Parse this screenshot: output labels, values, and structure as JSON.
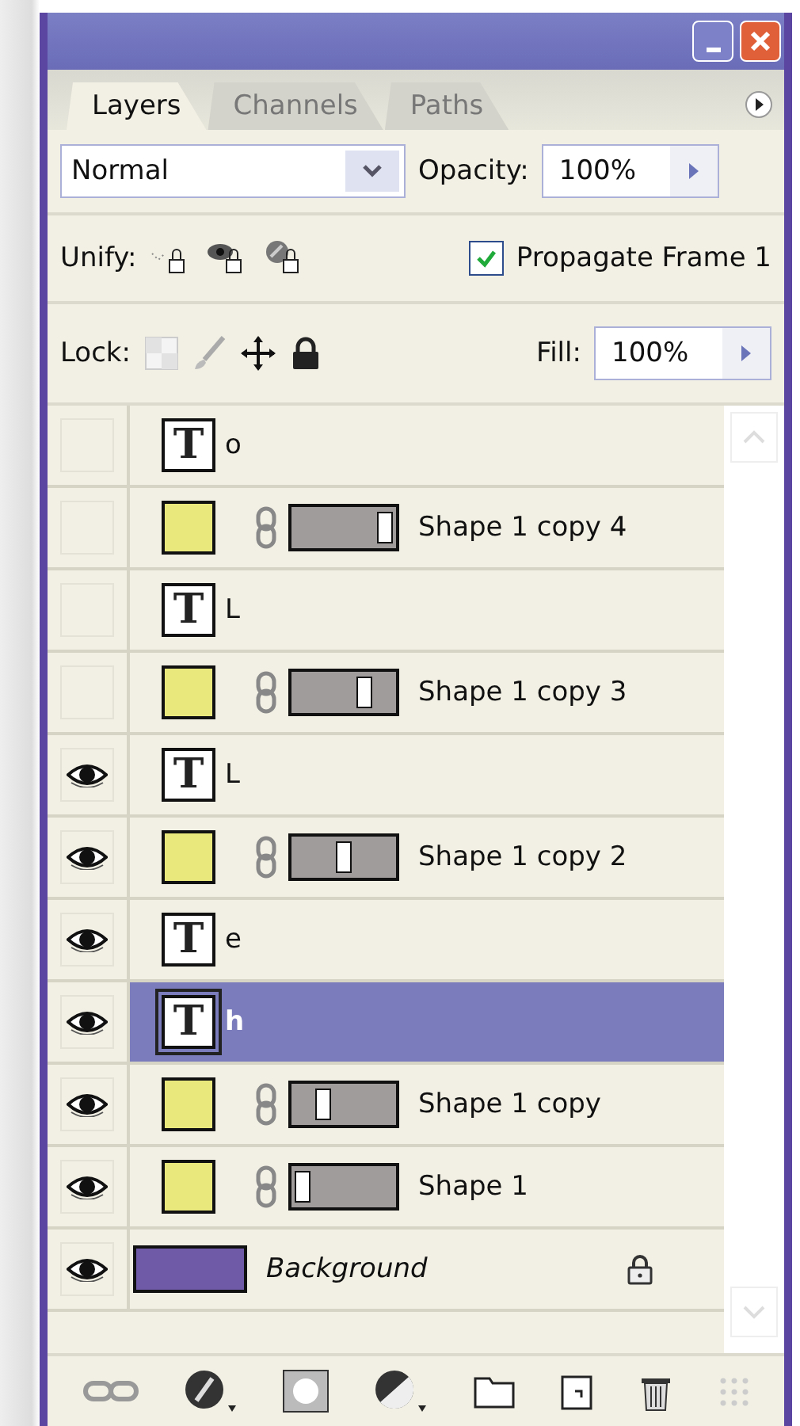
{
  "tabs": [
    {
      "label": "Layers",
      "selected": true
    },
    {
      "label": "Channels",
      "selected": false
    },
    {
      "label": "Paths",
      "selected": false
    }
  ],
  "blend_mode": {
    "value": "Normal"
  },
  "opacity": {
    "label": "Opacity:",
    "value": "100%"
  },
  "unify": {
    "label": "Unify:"
  },
  "propagate": {
    "label": "Propagate Frame 1",
    "checked": true
  },
  "lock": {
    "label": "Lock:"
  },
  "fill": {
    "label": "Fill:",
    "value": "100%"
  },
  "layers": [
    {
      "kind": "text",
      "glyph": "T",
      "name": "o",
      "visible": false,
      "selected": false
    },
    {
      "kind": "shape",
      "name": "Shape 1 copy 4",
      "visible": false,
      "selected": false,
      "color": "#e8e87c",
      "mask": {
        "level": 0.9
      }
    },
    {
      "kind": "text",
      "glyph": "T",
      "name": "L",
      "visible": false,
      "selected": false
    },
    {
      "kind": "shape",
      "name": "Shape 1 copy 3",
      "visible": false,
      "selected": false,
      "color": "#e8e87c",
      "mask": {
        "level": 0.7
      }
    },
    {
      "kind": "text",
      "glyph": "T",
      "name": "L",
      "visible": true,
      "selected": false
    },
    {
      "kind": "shape",
      "name": "Shape 1 copy 2",
      "visible": true,
      "selected": false,
      "color": "#e8e87c",
      "mask": {
        "level": 0.5
      }
    },
    {
      "kind": "text",
      "glyph": "T",
      "name": "e",
      "visible": true,
      "selected": false
    },
    {
      "kind": "text",
      "glyph": "T",
      "name": "h",
      "visible": true,
      "selected": true
    },
    {
      "kind": "shape",
      "name": "Shape 1 copy",
      "visible": true,
      "selected": false,
      "color": "#e8e87c",
      "mask": {
        "level": 0.3
      }
    },
    {
      "kind": "shape",
      "name": "Shape 1",
      "visible": true,
      "selected": false,
      "color": "#e8e87c",
      "mask": {
        "level": 0.1
      }
    },
    {
      "kind": "background",
      "name": "Background",
      "visible": true,
      "selected": false,
      "color": "#6f5aa8",
      "locked": true
    }
  ]
}
